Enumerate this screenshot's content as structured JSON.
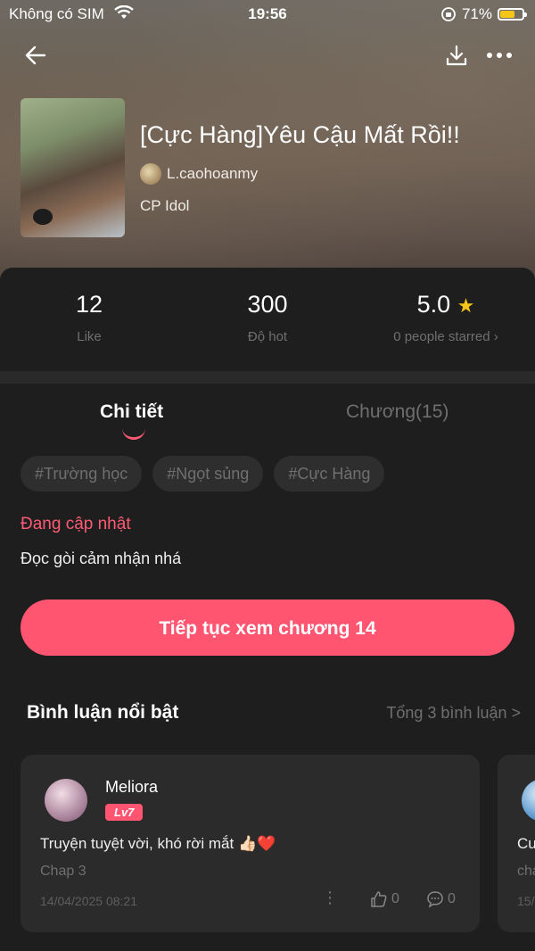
{
  "status_bar": {
    "carrier": "Không có SIM",
    "time": "19:56",
    "battery": "71%",
    "battery_level": 0.71
  },
  "book": {
    "title": "[Cực Hàng]Yêu Cậu Mất Rồi!!",
    "author": "L.caohoanmy",
    "category": "CP Idol"
  },
  "stats": {
    "likes": "12",
    "likes_label": "Like",
    "hot": "300",
    "hot_label": "Độ hot",
    "rating": "5.0",
    "rating_label": "0 people starred",
    "rating_chevron": "›"
  },
  "tabs": {
    "details": "Chi tiết",
    "chapters": "Chương(15)"
  },
  "tags": [
    "#Trường học",
    "#Ngọt sủng",
    "#Cực Hàng"
  ],
  "update_status": "Đang cập nhật",
  "description": "Đọc gòi cảm nhận nhá",
  "continue_button": "Tiếp tục xem chương 14",
  "comments": {
    "heading": "Bình luận nổi bật",
    "total": "Tổng 3 bình luận >",
    "items": [
      {
        "user": "Meliora",
        "level": "Lv7",
        "text": "Truyện tuyệt vời, khó rời mắt 👍🏻❤️",
        "chapter": "Chap 3",
        "date": "14/04/2025 08:21",
        "likes": "0",
        "replies": "0"
      },
      {
        "text": "Cu",
        "chapter": "cha",
        "date": "15/"
      }
    ]
  },
  "colors": {
    "accent": "#ff5570",
    "panel": "#1e1e1e",
    "card": "#2b2b2b"
  }
}
